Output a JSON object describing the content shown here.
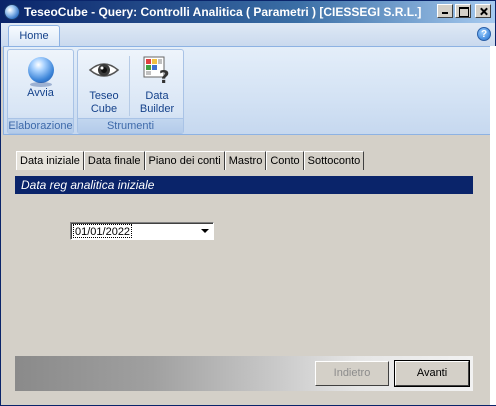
{
  "window": {
    "title": "TeseoCube - Query: Controlli Analitica ( Parametri ) [CIESSEGI S.R.L.]"
  },
  "ribbon": {
    "tabs": [
      {
        "label": "Home",
        "selected": true
      }
    ],
    "groups": [
      {
        "label": "Elaborazione",
        "buttons": [
          {
            "label": "Avvia",
            "icon": "globe-icon"
          }
        ]
      },
      {
        "label": "Strumenti",
        "buttons": [
          {
            "label_line1": "Teseo",
            "label_line2": "Cube",
            "icon": "eye-icon"
          },
          {
            "label_line1": "Data",
            "label_line2": "Builder",
            "icon": "data-builder-icon"
          }
        ]
      }
    ],
    "help_icon": "help-icon"
  },
  "tabs": [
    {
      "label": "Data iniziale",
      "active": true
    },
    {
      "label": "Data finale"
    },
    {
      "label": "Piano dei conti"
    },
    {
      "label": "Mastro"
    },
    {
      "label": "Conto"
    },
    {
      "label": "Sottoconto"
    }
  ],
  "section": {
    "header": "Data reg analitica iniziale"
  },
  "date_field": {
    "value": "01/01/2022"
  },
  "buttons": {
    "back_label": "Indietro",
    "next_label": "Avanti"
  },
  "colors": {
    "section_header_bg": "#0a246a",
    "ribbon_text": "#15428b"
  }
}
